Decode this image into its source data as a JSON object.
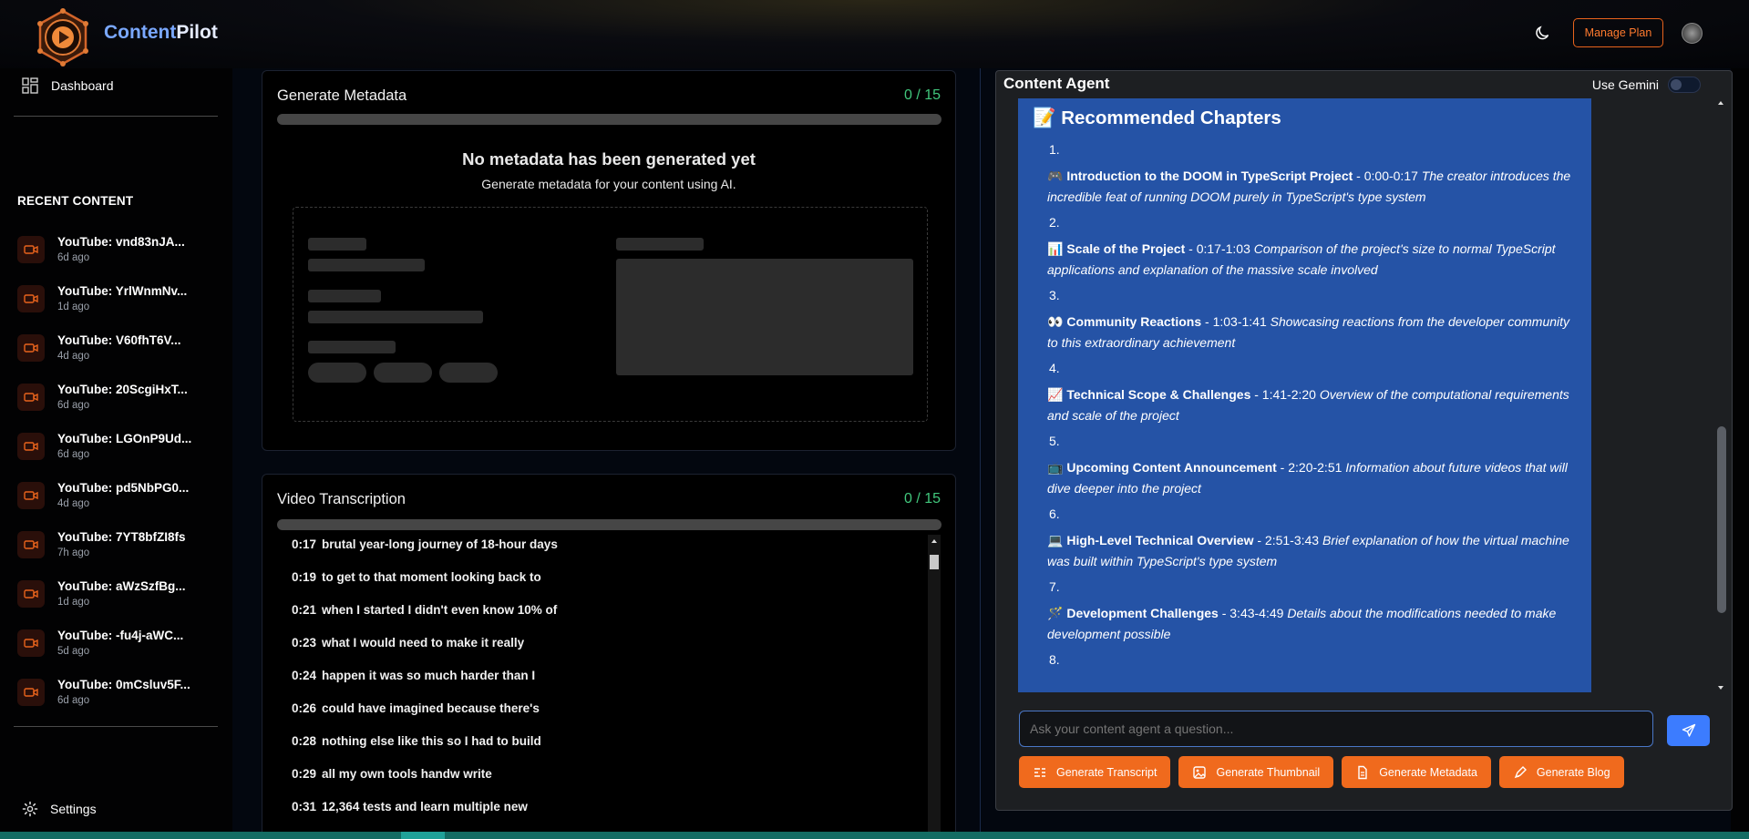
{
  "header": {
    "brand_part1": "Content",
    "brand_part2": "Pilot",
    "manage_plan": "Manage Plan",
    "theme_icon": "moon-icon",
    "colors": {
      "accent": "#f06a1d",
      "brand_blue": "#7aa8ff",
      "progress_green": "#41c77c",
      "chat_bg": "#2553a6"
    }
  },
  "sidebar": {
    "dashboard": "Dashboard",
    "recent_heading": "RECENT CONTENT",
    "recent": [
      {
        "title": "YouTube: vnd83nJA...",
        "time": "6d ago"
      },
      {
        "title": "YouTube: YrlWnmNv...",
        "time": "1d ago"
      },
      {
        "title": "YouTube: V60fhT6V...",
        "time": "4d ago"
      },
      {
        "title": "YouTube: 20ScgiHxT...",
        "time": "6d ago"
      },
      {
        "title": "YouTube: LGOnP9Ud...",
        "time": "6d ago"
      },
      {
        "title": "YouTube: pd5NbPG0...",
        "time": "4d ago"
      },
      {
        "title": "YouTube: 7YT8bfZI8fs",
        "time": "7h ago"
      },
      {
        "title": "YouTube: aWzSzfBg...",
        "time": "1d ago"
      },
      {
        "title": "YouTube: -fu4j-aWC...",
        "time": "5d ago"
      },
      {
        "title": "YouTube: 0mCsluv5F...",
        "time": "6d ago"
      }
    ],
    "settings": "Settings"
  },
  "metadata": {
    "title": "Generate Metadata",
    "count": "0 / 15",
    "progress": 0,
    "empty_heading": "No metadata has been generated yet",
    "empty_sub": "Generate metadata for your content using AI."
  },
  "transcription": {
    "title": "Video Transcription",
    "count": "0 / 15",
    "progress": 0,
    "lines": [
      {
        "t": "0:17",
        "text": "brutal year-long journey of 18-hour days"
      },
      {
        "t": "0:19",
        "text": "to get to that moment looking back to"
      },
      {
        "t": "0:21",
        "text": "when I started I didn't even know 10% of"
      },
      {
        "t": "0:23",
        "text": "what I would need to make it really"
      },
      {
        "t": "0:24",
        "text": "happen it was so much harder than I"
      },
      {
        "t": "0:26",
        "text": "could have imagined because there's"
      },
      {
        "t": "0:28",
        "text": "nothing else like this so I had to build"
      },
      {
        "t": "0:29",
        "text": "all my own tools handw write"
      },
      {
        "t": "0:31",
        "text": "12,364 tests and learn multiple new"
      }
    ]
  },
  "agent": {
    "title": "Content Agent",
    "use_gemini": "Use Gemini",
    "gemini_enabled": false,
    "chapters_heading": "📝 Recommended Chapters",
    "chapters": [
      {
        "num": "1.",
        "emoji": "🎮",
        "name": "Introduction to the DOOM in TypeScript Project",
        "range": " - 0:00-0:17 ",
        "desc": "The creator introduces the incredible feat of running DOOM purely in TypeScript's type system"
      },
      {
        "num": "2.",
        "emoji": "📊",
        "name": "Scale of the Project",
        "range": " - 0:17-1:03 ",
        "desc": "Comparison of the project's size to normal TypeScript applications and explanation of the massive scale involved"
      },
      {
        "num": "3.",
        "emoji": "👀",
        "name": "Community Reactions",
        "range": " - 1:03-1:41 ",
        "desc": "Showcasing reactions from the developer community to this extraordinary achievement"
      },
      {
        "num": "4.",
        "emoji": "📈",
        "name": "Technical Scope & Challenges",
        "range": " - 1:41-2:20 ",
        "desc": "Overview of the computational requirements and scale of the project"
      },
      {
        "num": "5.",
        "emoji": "📺",
        "name": "Upcoming Content Announcement",
        "range": " - 2:20-2:51 ",
        "desc": "Information about future videos that will dive deeper into the project"
      },
      {
        "num": "6.",
        "emoji": "💻",
        "name": "High-Level Technical Overview",
        "range": " - 2:51-3:43 ",
        "desc": "Brief explanation of how the virtual machine was built within TypeScript's type system"
      },
      {
        "num": "7.",
        "emoji": "🪄",
        "name": "Development Challenges",
        "range": " - 3:43-4:49 ",
        "desc": "Details about the modifications needed to make development possible"
      },
      {
        "num": "8.",
        "emoji": "",
        "name": "",
        "range": "",
        "desc": ""
      }
    ],
    "input_placeholder": "Ask your content agent a question...",
    "buttons": [
      {
        "label": "Generate Transcript",
        "icon": "transcript-icon"
      },
      {
        "label": "Generate Thumbnail",
        "icon": "image-icon"
      },
      {
        "label": "Generate Metadata",
        "icon": "document-icon"
      },
      {
        "label": "Generate Blog",
        "icon": "pen-icon"
      }
    ]
  }
}
